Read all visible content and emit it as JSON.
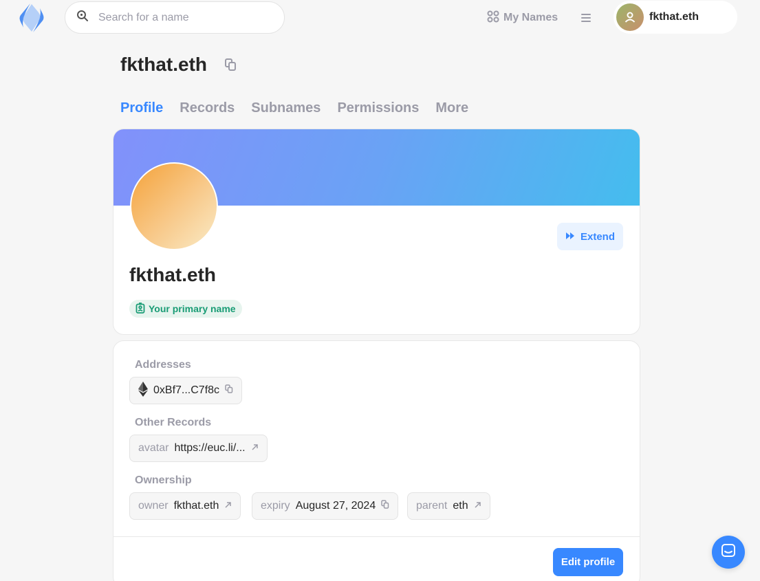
{
  "header": {
    "logo_icon": "ens-logo-icon",
    "search": {
      "placeholder": "Search for a name",
      "value": ""
    },
    "my_names_label": "My Names",
    "menu_icon": "hamburger-menu-icon",
    "account_name": "fkthat.eth"
  },
  "page": {
    "title": "fkthat.eth",
    "copy_icon": "copy-icon"
  },
  "tabs": [
    {
      "label": "Profile",
      "active": true
    },
    {
      "label": "Records",
      "active": false
    },
    {
      "label": "Subnames",
      "active": false
    },
    {
      "label": "Permissions",
      "active": false
    },
    {
      "label": "More",
      "active": false
    }
  ],
  "profile": {
    "name": "fkthat.eth",
    "extend_label": "Extend",
    "primary_badge": "Your primary name"
  },
  "records": {
    "addresses_label": "Addresses",
    "address": {
      "coin_icon": "ethereum-icon",
      "value": "0xBf7...C7f8c"
    },
    "other_label": "Other Records",
    "avatar": {
      "key": "avatar",
      "value": "https://euc.li/..."
    },
    "ownership_label": "Ownership",
    "owner": {
      "key": "owner",
      "value": "fkthat.eth"
    },
    "expiry": {
      "key": "expiry",
      "value": "August 27, 2024"
    },
    "parent": {
      "key": "parent",
      "value": "eth"
    },
    "edit_label": "Edit profile"
  },
  "colors": {
    "accent": "#3888ff",
    "muted": "#9b9ba7",
    "green": "#199c75",
    "banner_start": "#8291fb",
    "banner_end": "#44bdee"
  }
}
